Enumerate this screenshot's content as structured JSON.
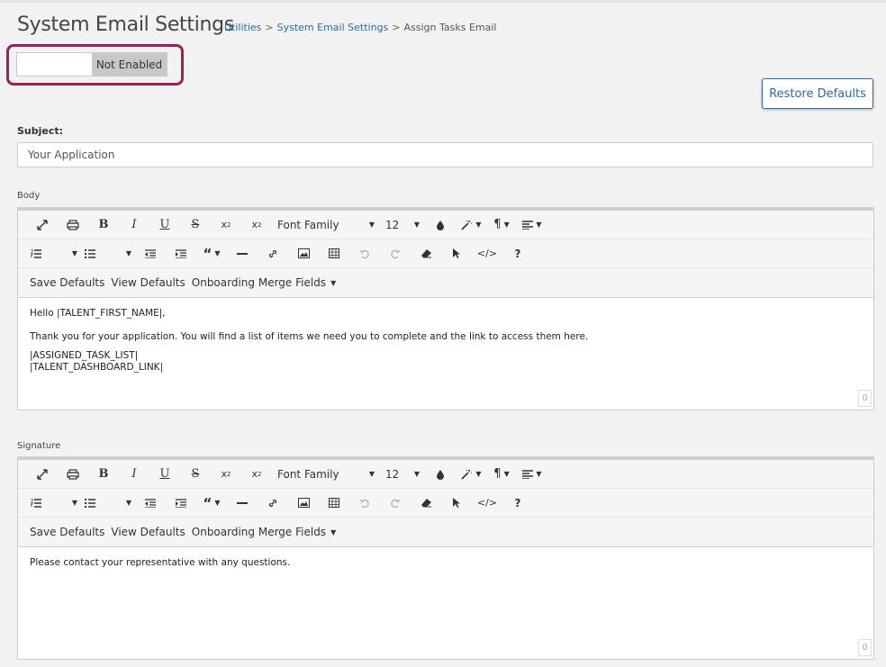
{
  "page": {
    "title": "System Email Settings",
    "breadcrumb": [
      {
        "label": "Utilities",
        "link": true
      },
      {
        "label": "System Email Settings",
        "link": true
      },
      {
        "label": "Assign Tasks Email",
        "link": false
      }
    ],
    "breadcrumb_separator": ">"
  },
  "toggle": {
    "state_label": "Not Enabled"
  },
  "restore_defaults_label": "Restore Defaults",
  "subject": {
    "label": "Subject:",
    "value": "Your Application"
  },
  "toolbar": {
    "font_family": "Font Family",
    "font_size": "12",
    "menu_save_defaults": "Save Defaults",
    "menu_view_defaults": "View Defaults",
    "menu_merge_fields": "Onboarding Merge Fields",
    "icons": [
      "fullscreen-icon",
      "print-icon",
      "bold-icon",
      "italic-icon",
      "underline-icon",
      "strikethrough-icon",
      "subscript-icon",
      "superscript-icon",
      "font-family-dropdown",
      "font-size-dropdown",
      "color-icon",
      "magic-wand-icon",
      "paragraph-icon",
      "align-icon",
      "ordered-list-icon",
      "unordered-list-icon",
      "outdent-icon",
      "indent-icon",
      "quote-icon",
      "horizontal-rule-icon",
      "link-icon",
      "image-icon",
      "table-icon",
      "undo-icon",
      "redo-icon",
      "eraser-icon",
      "pointer-icon",
      "code-view-icon",
      "help-icon"
    ]
  },
  "body": {
    "label": "Body",
    "lines": [
      "Hello |TALENT_FIRST_NAME|,",
      "Thank you for your application. You will find a list of items we need you to complete and the link to access them here.",
      "|ASSIGNED_TASK_LIST|",
      "|TALENT_DASHBOARD_LINK|"
    ],
    "counter": "0"
  },
  "signature": {
    "label": "Signature",
    "lines": [
      "Please contact your representative with any questions."
    ],
    "counter": "0"
  },
  "colors": {
    "accent": "#2a6aa8",
    "highlight": "#9b1f5a"
  }
}
